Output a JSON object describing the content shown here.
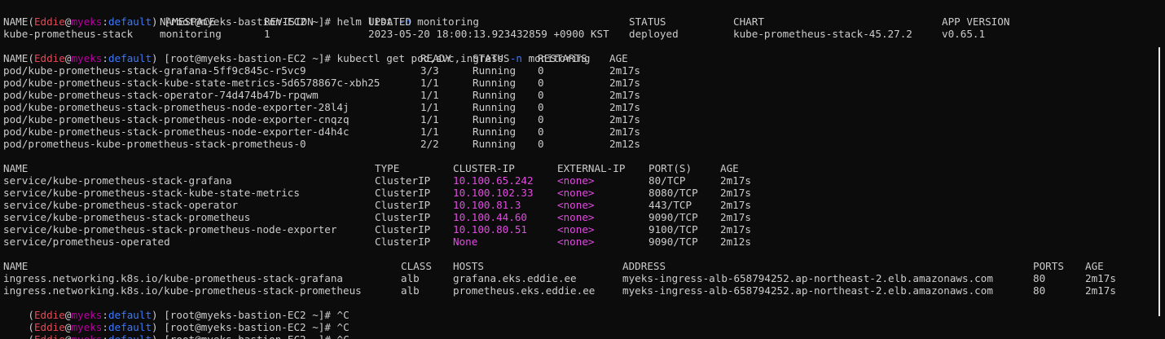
{
  "terminal": {
    "prompt": {
      "paren_open": "(",
      "user": "Eddie",
      "at": "@",
      "cluster": "myeks",
      "colon": ":",
      "namespace": "default",
      "paren_close": ")",
      "host": " [root@myeks-bastion-EC2 ~]# "
    },
    "cmd1": {
      "text": "helm list ",
      "flag": "-n",
      "arg": " monitoring"
    },
    "cmd2": {
      "text": "kubectl get pod,svc,ingress ",
      "flag": "-n",
      "arg": " monitoring"
    },
    "cmd3": "^C",
    "helm": {
      "headers": [
        "NAME",
        "NAMESPACE",
        "REVISION",
        "UPDATED",
        "STATUS",
        "CHART",
        "APP VERSION"
      ],
      "rows": [
        [
          "kube-prometheus-stack",
          "monitoring",
          "1",
          "2023-05-20 18:00:13.923432859 +0900 KST",
          "deployed",
          "kube-prometheus-stack-45.27.2",
          "v0.65.1"
        ]
      ]
    },
    "pods": {
      "headers": [
        "NAME",
        "READY",
        "STATUS",
        "RESTARTS",
        "AGE"
      ],
      "rows": [
        [
          "pod/kube-prometheus-stack-grafana-5ff9c845c-r5vc9",
          "3/3",
          "Running",
          "0",
          "2m17s"
        ],
        [
          "pod/kube-prometheus-stack-kube-state-metrics-5d6578867c-xbh25",
          "1/1",
          "Running",
          "0",
          "2m17s"
        ],
        [
          "pod/kube-prometheus-stack-operator-74d474b47b-rpqwm",
          "1/1",
          "Running",
          "0",
          "2m17s"
        ],
        [
          "pod/kube-prometheus-stack-prometheus-node-exporter-28l4j",
          "1/1",
          "Running",
          "0",
          "2m17s"
        ],
        [
          "pod/kube-prometheus-stack-prometheus-node-exporter-cnqzq",
          "1/1",
          "Running",
          "0",
          "2m17s"
        ],
        [
          "pod/kube-prometheus-stack-prometheus-node-exporter-d4h4c",
          "1/1",
          "Running",
          "0",
          "2m17s"
        ],
        [
          "pod/prometheus-kube-prometheus-stack-prometheus-0",
          "2/2",
          "Running",
          "0",
          "2m12s"
        ]
      ]
    },
    "services": {
      "headers": [
        "NAME",
        "TYPE",
        "CLUSTER-IP",
        "EXTERNAL-IP",
        "PORT(S)",
        "AGE"
      ],
      "rows": [
        [
          "service/kube-prometheus-stack-grafana",
          "ClusterIP",
          "10.100.65.242",
          "<none>",
          "80/TCP",
          "2m17s"
        ],
        [
          "service/kube-prometheus-stack-kube-state-metrics",
          "ClusterIP",
          "10.100.102.33",
          "<none>",
          "8080/TCP",
          "2m17s"
        ],
        [
          "service/kube-prometheus-stack-operator",
          "ClusterIP",
          "10.100.81.3",
          "<none>",
          "443/TCP",
          "2m17s"
        ],
        [
          "service/kube-prometheus-stack-prometheus",
          "ClusterIP",
          "10.100.44.60",
          "<none>",
          "9090/TCP",
          "2m17s"
        ],
        [
          "service/kube-prometheus-stack-prometheus-node-exporter",
          "ClusterIP",
          "10.100.80.51",
          "<none>",
          "9100/TCP",
          "2m17s"
        ],
        [
          "service/prometheus-operated",
          "ClusterIP",
          "None",
          "<none>",
          "9090/TCP",
          "2m12s"
        ]
      ]
    },
    "ingress": {
      "headers": [
        "NAME",
        "CLASS",
        "HOSTS",
        "ADDRESS",
        "PORTS",
        "AGE"
      ],
      "rows": [
        [
          "ingress.networking.k8s.io/kube-prometheus-stack-grafana",
          "alb",
          "grafana.eks.eddie.ee",
          "myeks-ingress-alb-658794252.ap-northeast-2.elb.amazonaws.com",
          "80",
          "2m17s"
        ],
        [
          "ingress.networking.k8s.io/kube-prometheus-stack-prometheus",
          "alb",
          "prometheus.eks.eddie.ee",
          "myeks-ingress-alb-658794252.ap-northeast-2.elb.amazonaws.com",
          "80",
          "2m17s"
        ]
      ]
    },
    "colors": {
      "background": "#0c0c0c",
      "foreground": "#cccccc",
      "user": "#e74856",
      "cluster": "#b4009e",
      "namespace": "#3b78ff",
      "ip_highlight": "#e14ce0"
    }
  }
}
